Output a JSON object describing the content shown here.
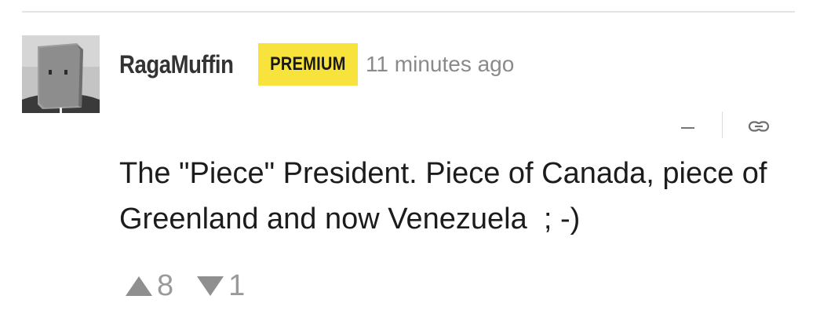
{
  "comment": {
    "author": "RagaMuffin",
    "badge": "PREMIUM",
    "timestamp": "11 minutes ago",
    "body": "The \"Piece\" President. Piece of Canada, piece of Greenland and now Venezuela  ; -)",
    "upvotes": "8",
    "downvotes": "1"
  },
  "icons": {
    "collapse": "minus-icon",
    "permalink": "link-icon",
    "upvote": "triangle-up-icon",
    "downvote": "triangle-down-icon"
  },
  "colors": {
    "badge_background": "#f7e33b",
    "author_text": "#333333",
    "timestamp_text": "#8a8a8a",
    "body_text": "#1c1c1c",
    "vote_text": "#9a9a9a"
  }
}
